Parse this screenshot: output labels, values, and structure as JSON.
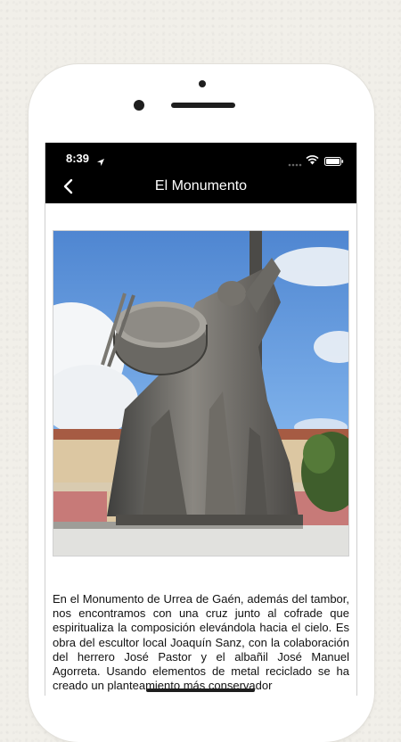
{
  "status_bar": {
    "time": "8:39"
  },
  "nav": {
    "title": "El Monumento"
  },
  "icons": {
    "back": "chevron-left-icon",
    "location": "location-arrow-icon",
    "signal": "cellular-signal-icon",
    "wifi": "wifi-icon",
    "battery": "battery-icon"
  },
  "content": {
    "paragraph": "En el Monumento de Urrea de Gaén, además del tambor, nos encontramos con una cruz junto al cofrade que espiritualiza la composición elevándola hacia el cielo. Es obra del escultor local Joaquín Sanz, con la colaboración del herrero José Pastor y el albañil José Manuel Agorreta. Usando elementos de metal reciclado se ha creado un planteamiento más conservador"
  },
  "colors": {
    "header_bg": "#000000",
    "header_text": "#ffffff",
    "page_bg": "#f1efe9"
  }
}
